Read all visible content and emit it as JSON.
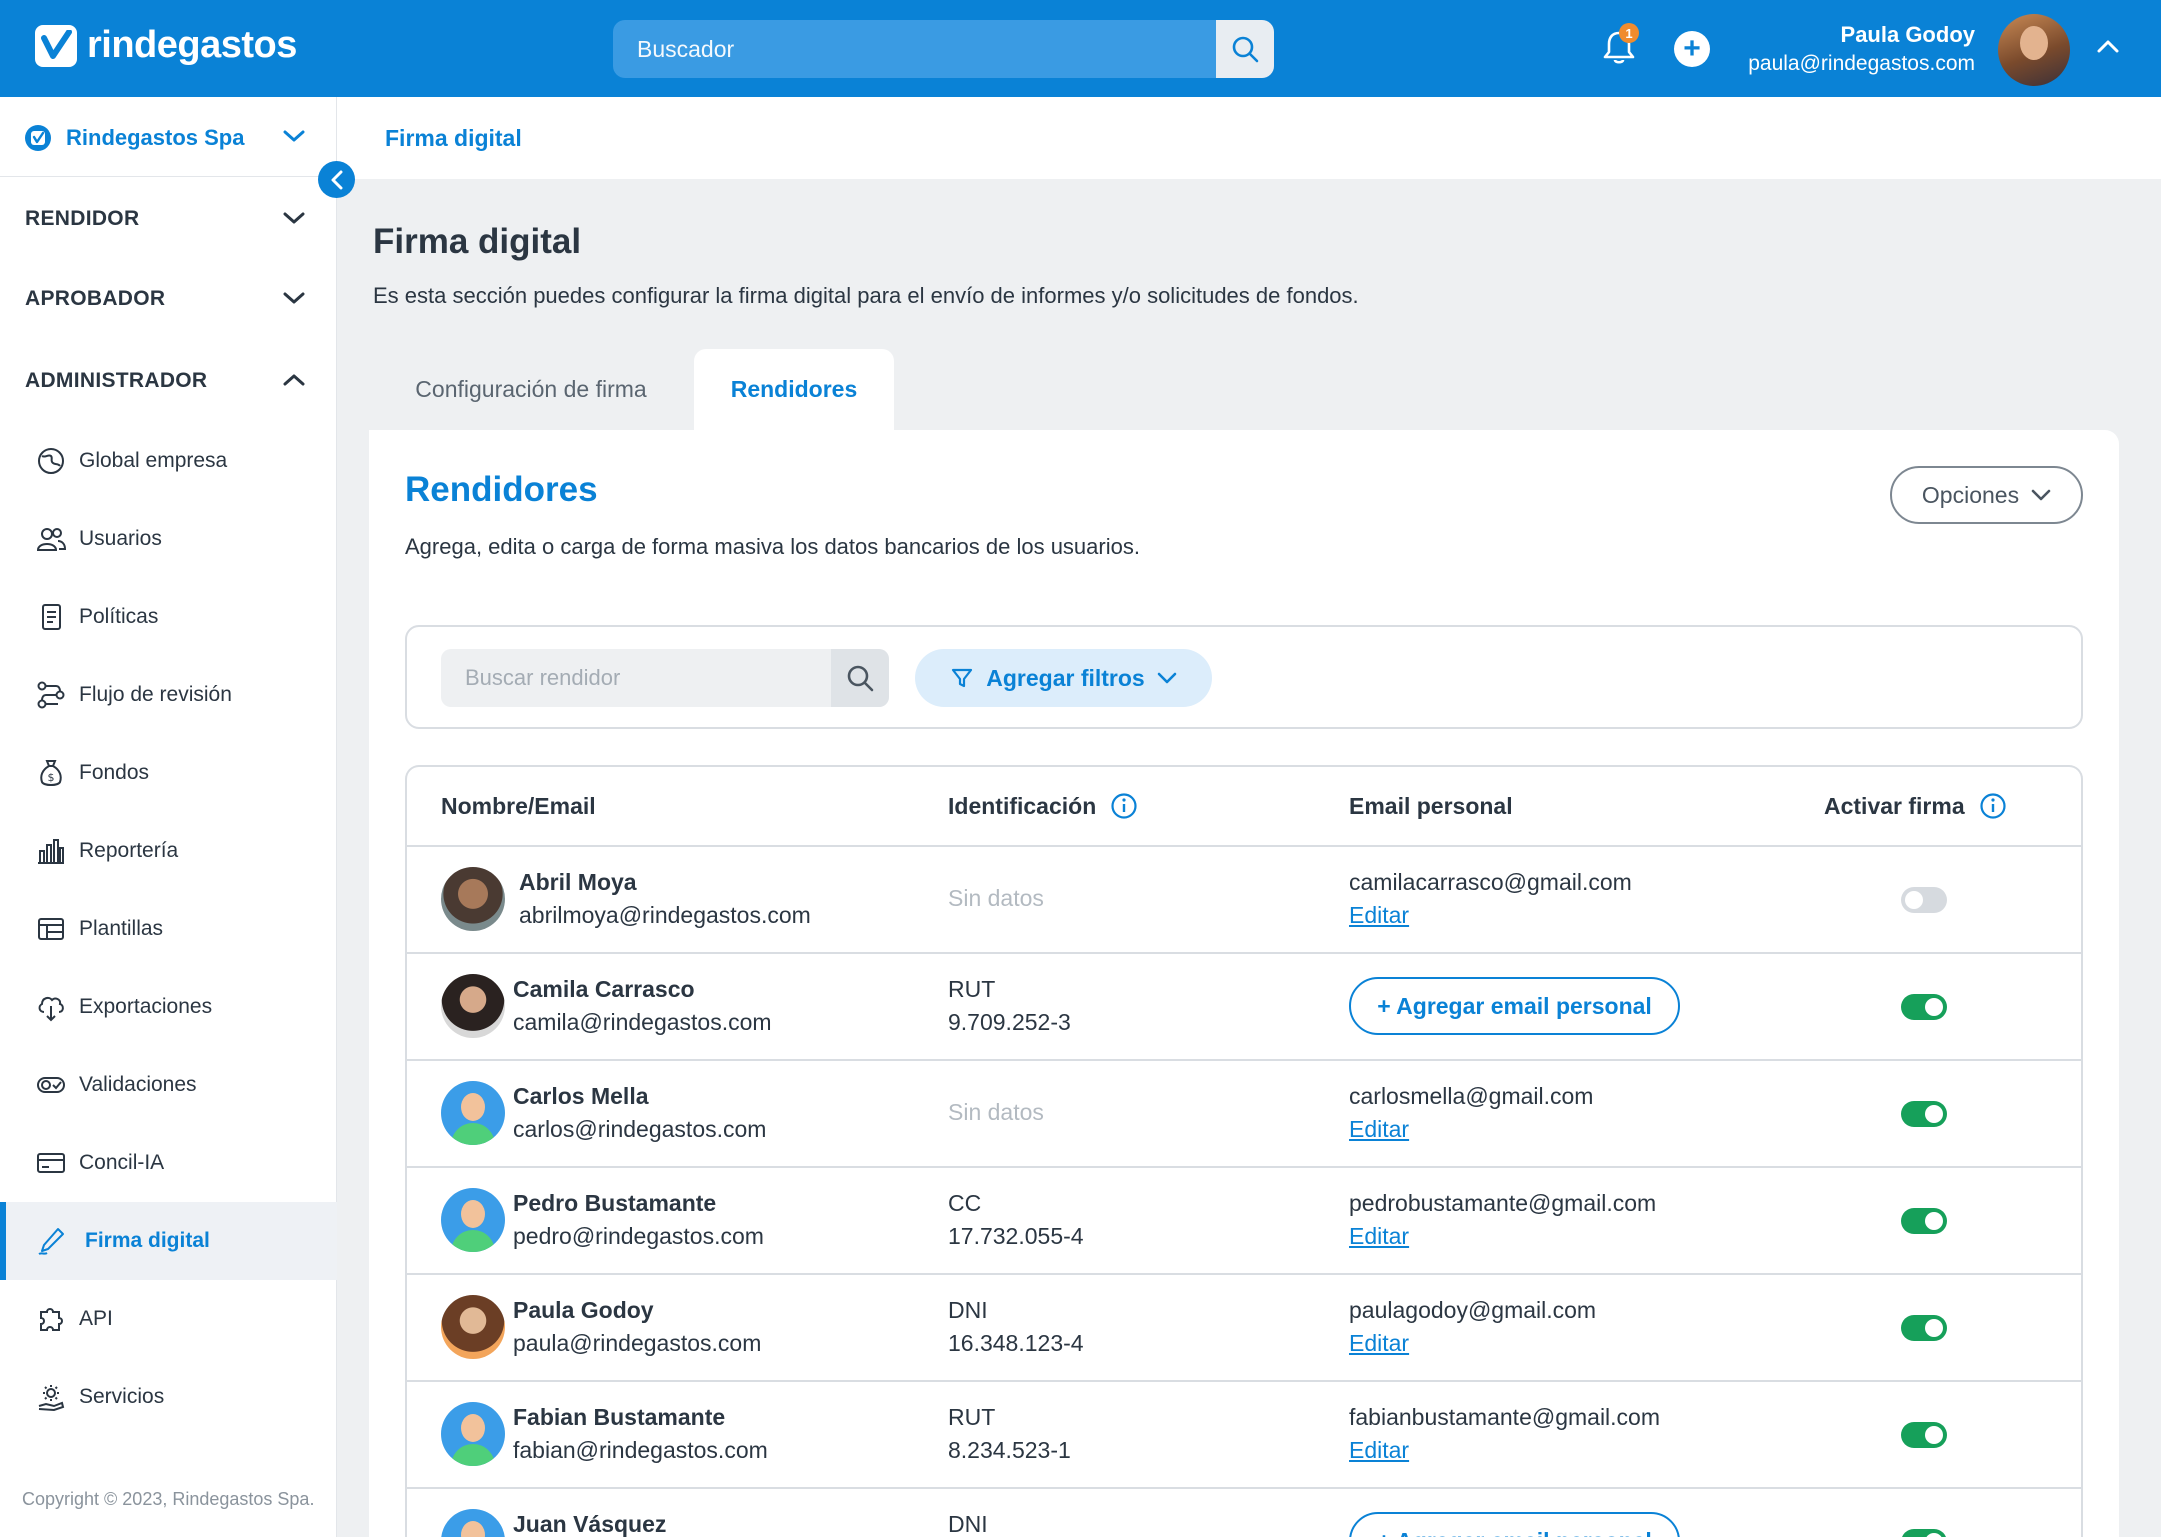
{
  "header": {
    "brand": "rindegastos",
    "search_placeholder": "Buscador",
    "notifications_count": "1",
    "user_name": "Paula Godoy",
    "user_email": "paula@rindegastos.com"
  },
  "sidebar": {
    "company": "Rindegastos Spa",
    "sections": {
      "rendidor": "RENDIDOR",
      "aprobador": "APROBADOR",
      "administrador": "ADMINISTRADOR"
    },
    "items": [
      {
        "label": "Global empresa",
        "icon": "globe-icon"
      },
      {
        "label": "Usuarios",
        "icon": "users-icon"
      },
      {
        "label": "Políticas",
        "icon": "policy-document-icon"
      },
      {
        "label": "Flujo de revisión",
        "icon": "review-flow-icon"
      },
      {
        "label": "Fondos",
        "icon": "money-bag-icon"
      },
      {
        "label": "Reportería",
        "icon": "bar-chart-icon"
      },
      {
        "label": "Plantillas",
        "icon": "template-icon"
      },
      {
        "label": "Exportaciones",
        "icon": "cloud-download-icon"
      },
      {
        "label": "Validaciones",
        "icon": "validation-icon"
      },
      {
        "label": "Concil-IA",
        "icon": "card-icon"
      },
      {
        "label": "Firma digital",
        "icon": "pen-icon"
      },
      {
        "label": "API",
        "icon": "puzzle-icon"
      },
      {
        "label": "Servicios",
        "icon": "gear-hand-icon"
      }
    ],
    "active_item": "Firma digital",
    "copyright": "Copyright © 2023, Rindegastos Spa."
  },
  "breadcrumb": "Firma digital",
  "page": {
    "title": "Firma digital",
    "description": "Es esta sección puedes configurar la firma digital para el envío de informes y/o solicitudes de fondos.",
    "tabs": [
      "Configuración de firma",
      "Rendidores"
    ],
    "active_tab": "Rendidores"
  },
  "card": {
    "title": "Rendidores",
    "description": "Agrega, edita o carga de forma masiva los datos bancarios de los usuarios.",
    "options_label": "Opciones",
    "search_placeholder": "Buscar rendidor",
    "filters_label": "Agregar filtros"
  },
  "table": {
    "columns": [
      "Nombre/Email",
      "Identificación",
      "Email personal",
      "Activar firma"
    ],
    "rows": [
      {
        "name": "Abril Moya",
        "email": "abrilmoya@rindegastos.com",
        "id_type": "",
        "id_number": "",
        "no_data": "Sin datos",
        "personal_email": "camilacarrasco@gmail.com",
        "edit": "Editar",
        "add_label": "",
        "active": false
      },
      {
        "name": "Camila Carrasco",
        "email": "camila@rindegastos.com",
        "id_type": "RUT",
        "id_number": "9.709.252-3",
        "no_data": "",
        "personal_email": "",
        "edit": "",
        "add_label": "+ Agregar email personal",
        "active": true
      },
      {
        "name": "Carlos Mella",
        "email": "carlos@rindegastos.com",
        "id_type": "",
        "id_number": "",
        "no_data": "Sin datos",
        "personal_email": "carlosmella@gmail.com",
        "edit": "Editar",
        "add_label": "",
        "active": true
      },
      {
        "name": "Pedro Bustamante",
        "email": "pedro@rindegastos.com",
        "id_type": "CC",
        "id_number": "17.732.055-4",
        "no_data": "",
        "personal_email": "pedrobustamante@gmail.com",
        "edit": "Editar",
        "add_label": "",
        "active": true
      },
      {
        "name": "Paula Godoy",
        "email": "paula@rindegastos.com",
        "id_type": "DNI",
        "id_number": "16.348.123-4",
        "no_data": "",
        "personal_email": "paulagodoy@gmail.com",
        "edit": "Editar",
        "add_label": "",
        "active": true
      },
      {
        "name": "Fabian Bustamante",
        "email": "fabian@rindegastos.com",
        "id_type": "RUT",
        "id_number": "8.234.523-1",
        "no_data": "",
        "personal_email": "fabianbustamante@gmail.com",
        "edit": "Editar",
        "add_label": "",
        "active": true
      },
      {
        "name": "Juan Vásquez",
        "email": "",
        "id_type": "DNI",
        "id_number": "",
        "no_data": "",
        "personal_email": "",
        "edit": "",
        "add_label": "+ Agregar email personal",
        "active": true
      }
    ]
  },
  "colors": {
    "primary": "#0a82d6",
    "toggle_on": "#16a05a",
    "toggle_off": "#d6dadf",
    "badge": "#f08c2e"
  }
}
